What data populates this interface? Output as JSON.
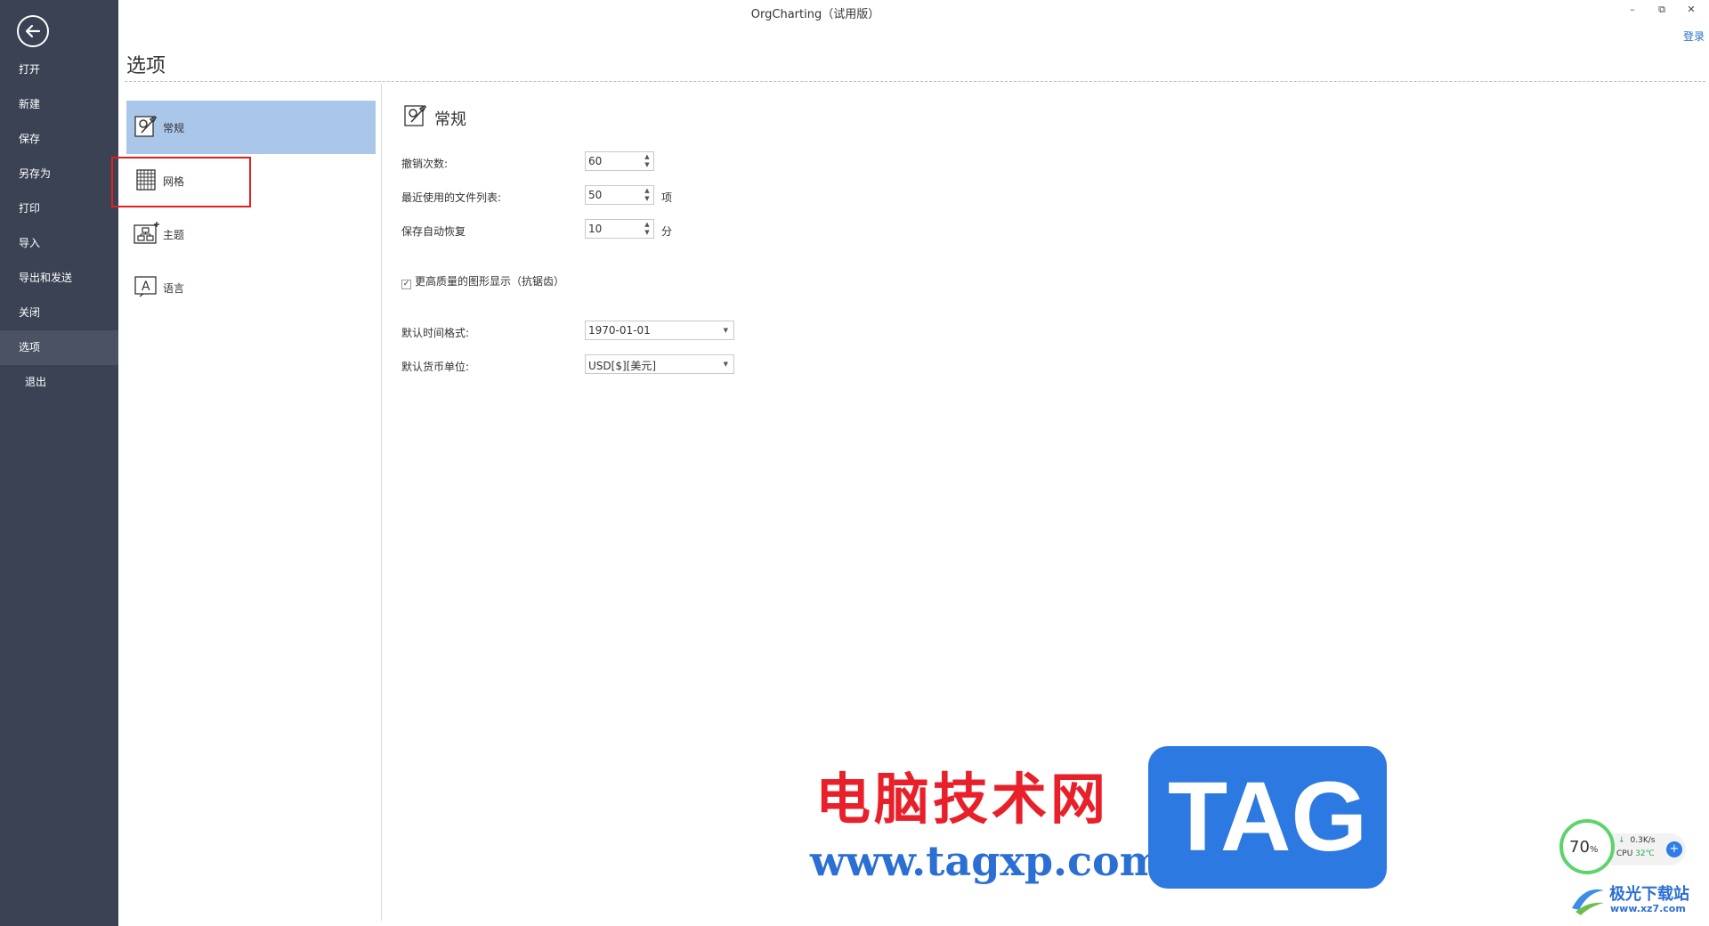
{
  "window": {
    "title": "OrgCharting（试用版）",
    "minimize_icon": "minimize-icon",
    "restore_icon": "restore-icon",
    "close_icon": "close-icon",
    "login": "登录"
  },
  "sidebar": {
    "back_icon": "arrow-left-icon",
    "items": [
      {
        "label": "打开"
      },
      {
        "label": "新建"
      },
      {
        "label": "保存"
      },
      {
        "label": "另存为"
      },
      {
        "label": "打印"
      },
      {
        "label": "导入"
      },
      {
        "label": "导出和发送"
      },
      {
        "label": "关闭"
      },
      {
        "label": "选项",
        "active": true
      },
      {
        "label": "退出"
      }
    ]
  },
  "page": {
    "heading": "选项",
    "categories": [
      {
        "label": "常规",
        "icon": "general-settings-icon",
        "selected": true
      },
      {
        "label": "网格",
        "icon": "grid-icon"
      },
      {
        "label": "主题",
        "icon": "theme-icon"
      },
      {
        "label": "语言",
        "icon": "language-icon"
      }
    ]
  },
  "general": {
    "title": "常规",
    "undo_label": "撤销次数:",
    "undo_value": "60",
    "recent_label": "最近使用的文件列表:",
    "recent_value": "50",
    "recent_unit": "项",
    "autosave_label": "保存自动恢复",
    "autosave_value": "10",
    "autosave_unit": "分",
    "antialias_label": "更高质量的图形显示（抗锯齿）",
    "antialias_checked": true,
    "date_format_label": "默认时间格式:",
    "date_format_value": "1970-01-01",
    "currency_label": "默认货币单位:",
    "currency_value": "USD[$][美元]"
  },
  "watermark": {
    "site_cn": "电脑技术网",
    "site_url": "www.tagxp.com",
    "tag": "TAG",
    "xz_cn": "极光下载站",
    "xz_url": "www.xz7.com"
  },
  "perf_widget": {
    "percent": "70",
    "percent_unit": "%",
    "net_speed": "0.3K/s",
    "cpu_label": "CPU",
    "cpu_temp": "32℃"
  }
}
